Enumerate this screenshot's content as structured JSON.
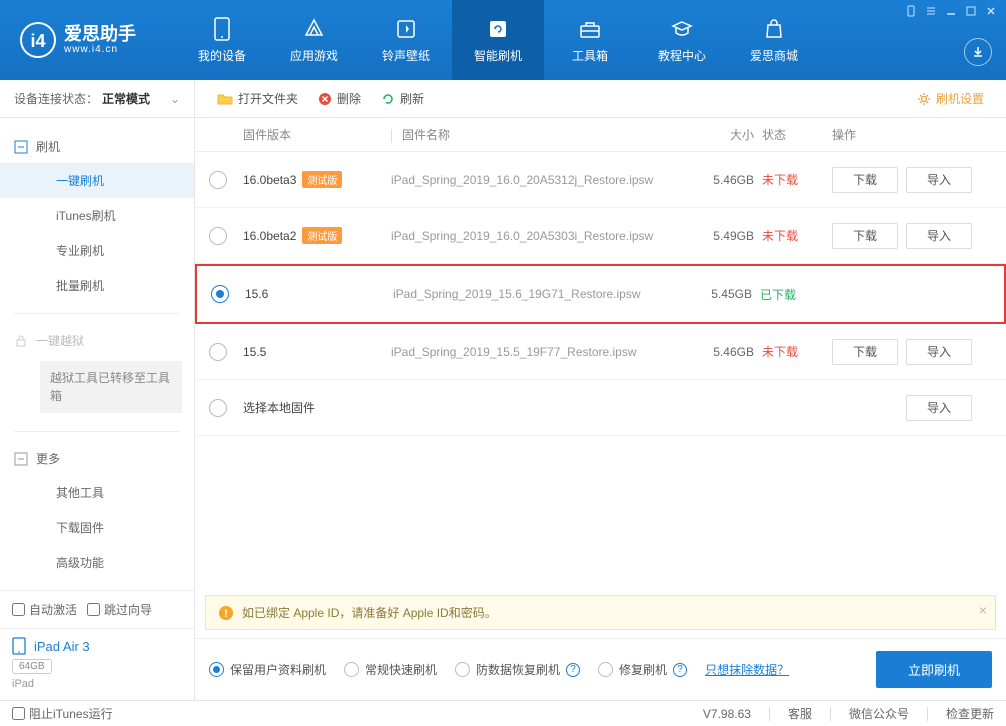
{
  "app": {
    "name_cn": "爱思助手",
    "url": "www.i4.cn"
  },
  "nav": [
    {
      "label": "我的设备"
    },
    {
      "label": "应用游戏"
    },
    {
      "label": "铃声壁纸"
    },
    {
      "label": "智能刷机"
    },
    {
      "label": "工具箱"
    },
    {
      "label": "教程中心"
    },
    {
      "label": "爱思商城"
    }
  ],
  "status": {
    "label": "设备连接状态：",
    "value": "正常模式"
  },
  "sidebar": {
    "flash_head": "刷机",
    "items": [
      "一键刷机",
      "iTunes刷机",
      "专业刷机",
      "批量刷机"
    ],
    "jailbreak_head": "一键越狱",
    "jailbreak_note": "越狱工具已转移至工具箱",
    "more_head": "更多",
    "more_items": [
      "其他工具",
      "下载固件",
      "高级功能"
    ],
    "auto_activate": "自动激活",
    "skip_guide": "跳过向导",
    "device": {
      "name": "iPad Air 3",
      "storage": "64GB",
      "type": "iPad"
    }
  },
  "toolbar": {
    "open": "打开文件夹",
    "delete": "删除",
    "refresh": "刷新",
    "settings": "刷机设置"
  },
  "table": {
    "headers": {
      "version": "固件版本",
      "name": "固件名称",
      "size": "大小",
      "status": "状态",
      "ops": "操作"
    },
    "download_btn": "下载",
    "import_btn": "导入",
    "beta_badge": "测试版",
    "local_label": "选择本地固件",
    "rows": [
      {
        "version": "16.0beta3",
        "beta": true,
        "name": "iPad_Spring_2019_16.0_20A5312j_Restore.ipsw",
        "size": "5.46GB",
        "status": "未下载",
        "status_cls": "nd",
        "selected": false,
        "hl": false,
        "ops": true
      },
      {
        "version": "16.0beta2",
        "beta": true,
        "name": "iPad_Spring_2019_16.0_20A5303i_Restore.ipsw",
        "size": "5.49GB",
        "status": "未下载",
        "status_cls": "nd",
        "selected": false,
        "hl": false,
        "ops": true
      },
      {
        "version": "15.6",
        "beta": false,
        "name": "iPad_Spring_2019_15.6_19G71_Restore.ipsw",
        "size": "5.45GB",
        "status": "已下载",
        "status_cls": "dl",
        "selected": true,
        "hl": true,
        "ops": false
      },
      {
        "version": "15.5",
        "beta": false,
        "name": "iPad_Spring_2019_15.5_19F77_Restore.ipsw",
        "size": "5.46GB",
        "status": "未下载",
        "status_cls": "nd",
        "selected": false,
        "hl": false,
        "ops": true
      }
    ]
  },
  "alert": "如已绑定 Apple ID，请准备好 Apple ID和密码。",
  "options": {
    "keep_data": "保留用户资料刷机",
    "normal": "常规快速刷机",
    "antidata": "防数据恢复刷机",
    "repair": "修复刷机",
    "erase_link": "只想抹除数据？",
    "flash_btn": "立即刷机"
  },
  "footer": {
    "block_itunes": "阻止iTunes运行",
    "version": "V7.98.63",
    "service": "客服",
    "wechat": "微信公众号",
    "update": "检查更新"
  }
}
